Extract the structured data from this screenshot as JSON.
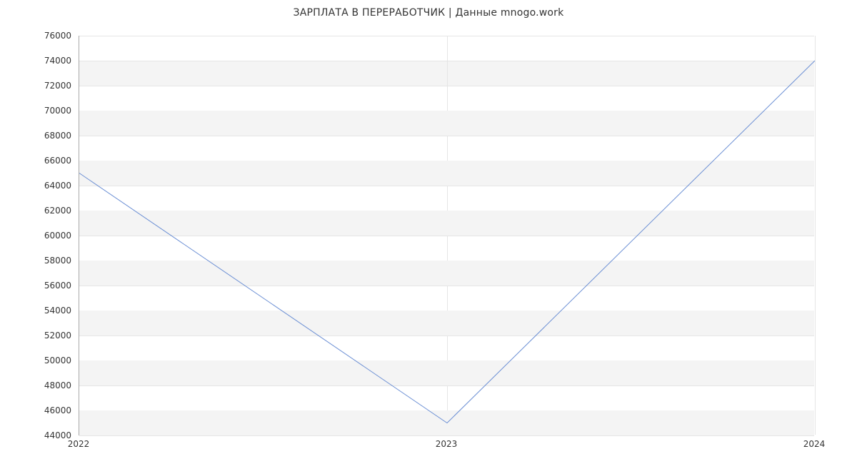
{
  "title": "ЗАРПЛАТА В ПЕРЕРАБОТЧИК | Данные mnogo.work",
  "colors": {
    "line": "#6b8fd4",
    "band": "#f4f4f4",
    "grid": "#e5e5e5",
    "axis": "#aaaaaa"
  },
  "chart_data": {
    "type": "line",
    "x": [
      2022,
      2023,
      2024
    ],
    "values": [
      65000,
      45000,
      74000
    ],
    "title": "ЗАРПЛАТА В ПЕРЕРАБОТЧИК | Данные mnogo.work",
    "xlabel": "",
    "ylabel": "",
    "xticks": [
      2022,
      2023,
      2024
    ],
    "yticks": [
      44000,
      46000,
      48000,
      50000,
      52000,
      54000,
      56000,
      58000,
      60000,
      62000,
      64000,
      66000,
      68000,
      70000,
      72000,
      74000,
      76000
    ],
    "ylim": [
      44000,
      76000
    ],
    "xlim": [
      2022,
      2024
    ],
    "grid": true,
    "legend": false
  }
}
